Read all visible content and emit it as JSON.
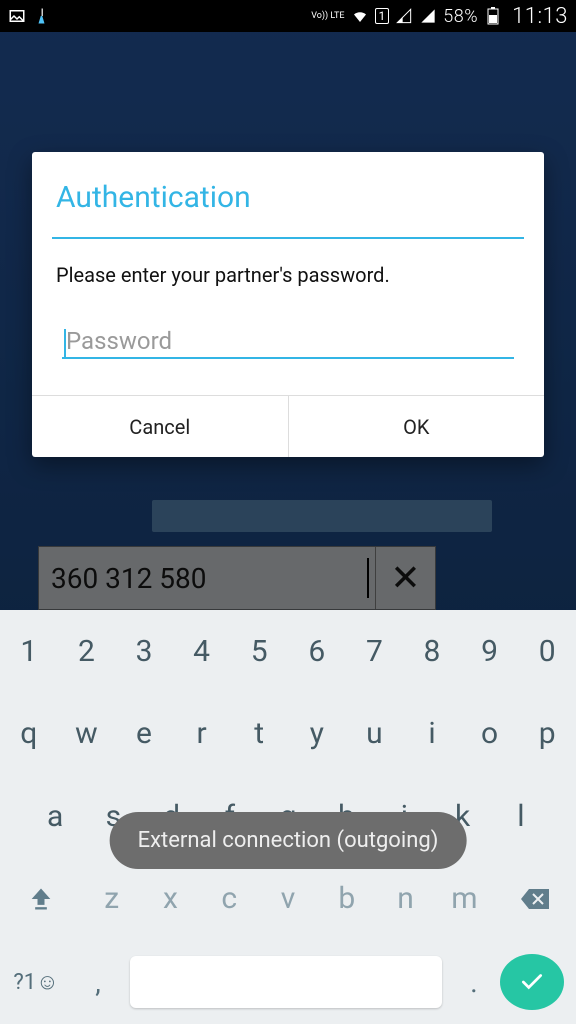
{
  "statusbar": {
    "volte": "Vo))\nLTE",
    "sim": "1",
    "battery": "58%",
    "time": "11:13"
  },
  "background": {
    "partner_id": "360 312 580"
  },
  "dialog": {
    "title": "Authentication",
    "message": "Please enter your partner's password.",
    "placeholder": "Password",
    "cancel": "Cancel",
    "ok": "OK"
  },
  "keyboard": {
    "row1": [
      "1",
      "2",
      "3",
      "4",
      "5",
      "6",
      "7",
      "8",
      "9",
      "0"
    ],
    "row2": [
      "q",
      "w",
      "e",
      "r",
      "t",
      "y",
      "u",
      "i",
      "o",
      "p"
    ],
    "row3": [
      "a",
      "s",
      "d",
      "f",
      "g",
      "h",
      "j",
      "k",
      "l"
    ],
    "row4": [
      "z",
      "x",
      "c",
      "v",
      "b",
      "n",
      "m"
    ],
    "sym": "?1☺",
    "comma": ",",
    "dot": "."
  },
  "toast": "External connection (outgoing)"
}
